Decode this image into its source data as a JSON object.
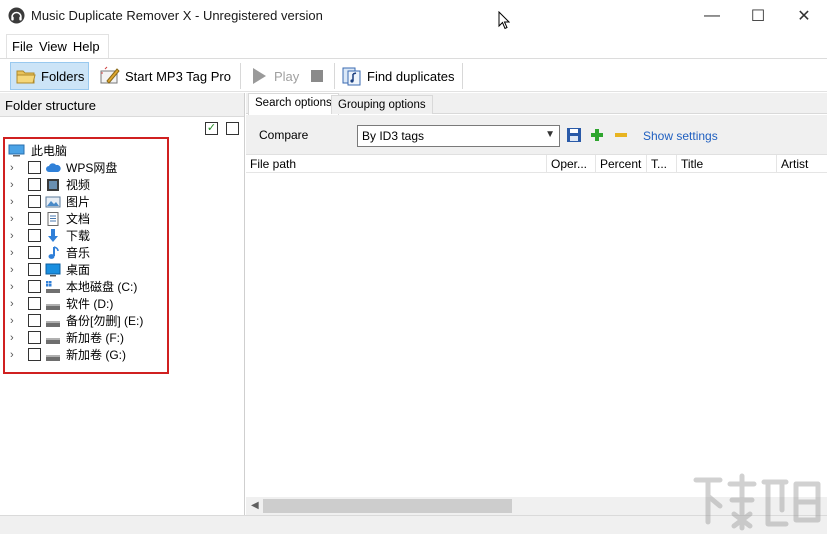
{
  "window": {
    "title": "Music Duplicate Remover X - Unregistered version",
    "minimize_glyph": "—",
    "maximize_glyph": "☐",
    "close_glyph": "✕"
  },
  "menu": {
    "items": [
      "File",
      "View",
      "Help"
    ]
  },
  "toolbar": {
    "folders_label": "Folders",
    "start_mp3_label": "Start MP3 Tag Pro",
    "play_label": "Play",
    "find_duplicates_label": "Find duplicates"
  },
  "left_panel": {
    "header": "Folder structure",
    "root_label": "此电脑",
    "nodes": [
      {
        "label": "WPS网盘",
        "icon": "cloud-icon"
      },
      {
        "label": "视频",
        "icon": "video-icon"
      },
      {
        "label": "图片",
        "icon": "pictures-icon"
      },
      {
        "label": "文档",
        "icon": "documents-icon"
      },
      {
        "label": "下载",
        "icon": "download-icon"
      },
      {
        "label": "音乐",
        "icon": "music-icon"
      },
      {
        "label": "桌面",
        "icon": "desktop-icon"
      },
      {
        "label": "本地磁盘 (C:)",
        "icon": "system-drive-icon"
      },
      {
        "label": "软件 (D:)",
        "icon": "drive-icon"
      },
      {
        "label": "备份[勿删] (E:)",
        "icon": "drive-icon"
      },
      {
        "label": "新加卷 (F:)",
        "icon": "drive-icon"
      },
      {
        "label": "新加卷 (G:)",
        "icon": "drive-icon"
      }
    ]
  },
  "right_panel": {
    "tabs": [
      {
        "label": "Search options",
        "active": true
      },
      {
        "label": "Grouping options",
        "active": false
      }
    ],
    "compare_label": "Compare",
    "compare_value": "By ID3 tags",
    "show_settings": "Show settings",
    "columns": [
      "File path",
      "Oper...",
      "Percent",
      "T...",
      "Title",
      "Artist"
    ]
  },
  "colors": {
    "accent": "#1f5fc0",
    "highlight_frame": "#d02020",
    "selected_tool": "#cce4f7"
  }
}
